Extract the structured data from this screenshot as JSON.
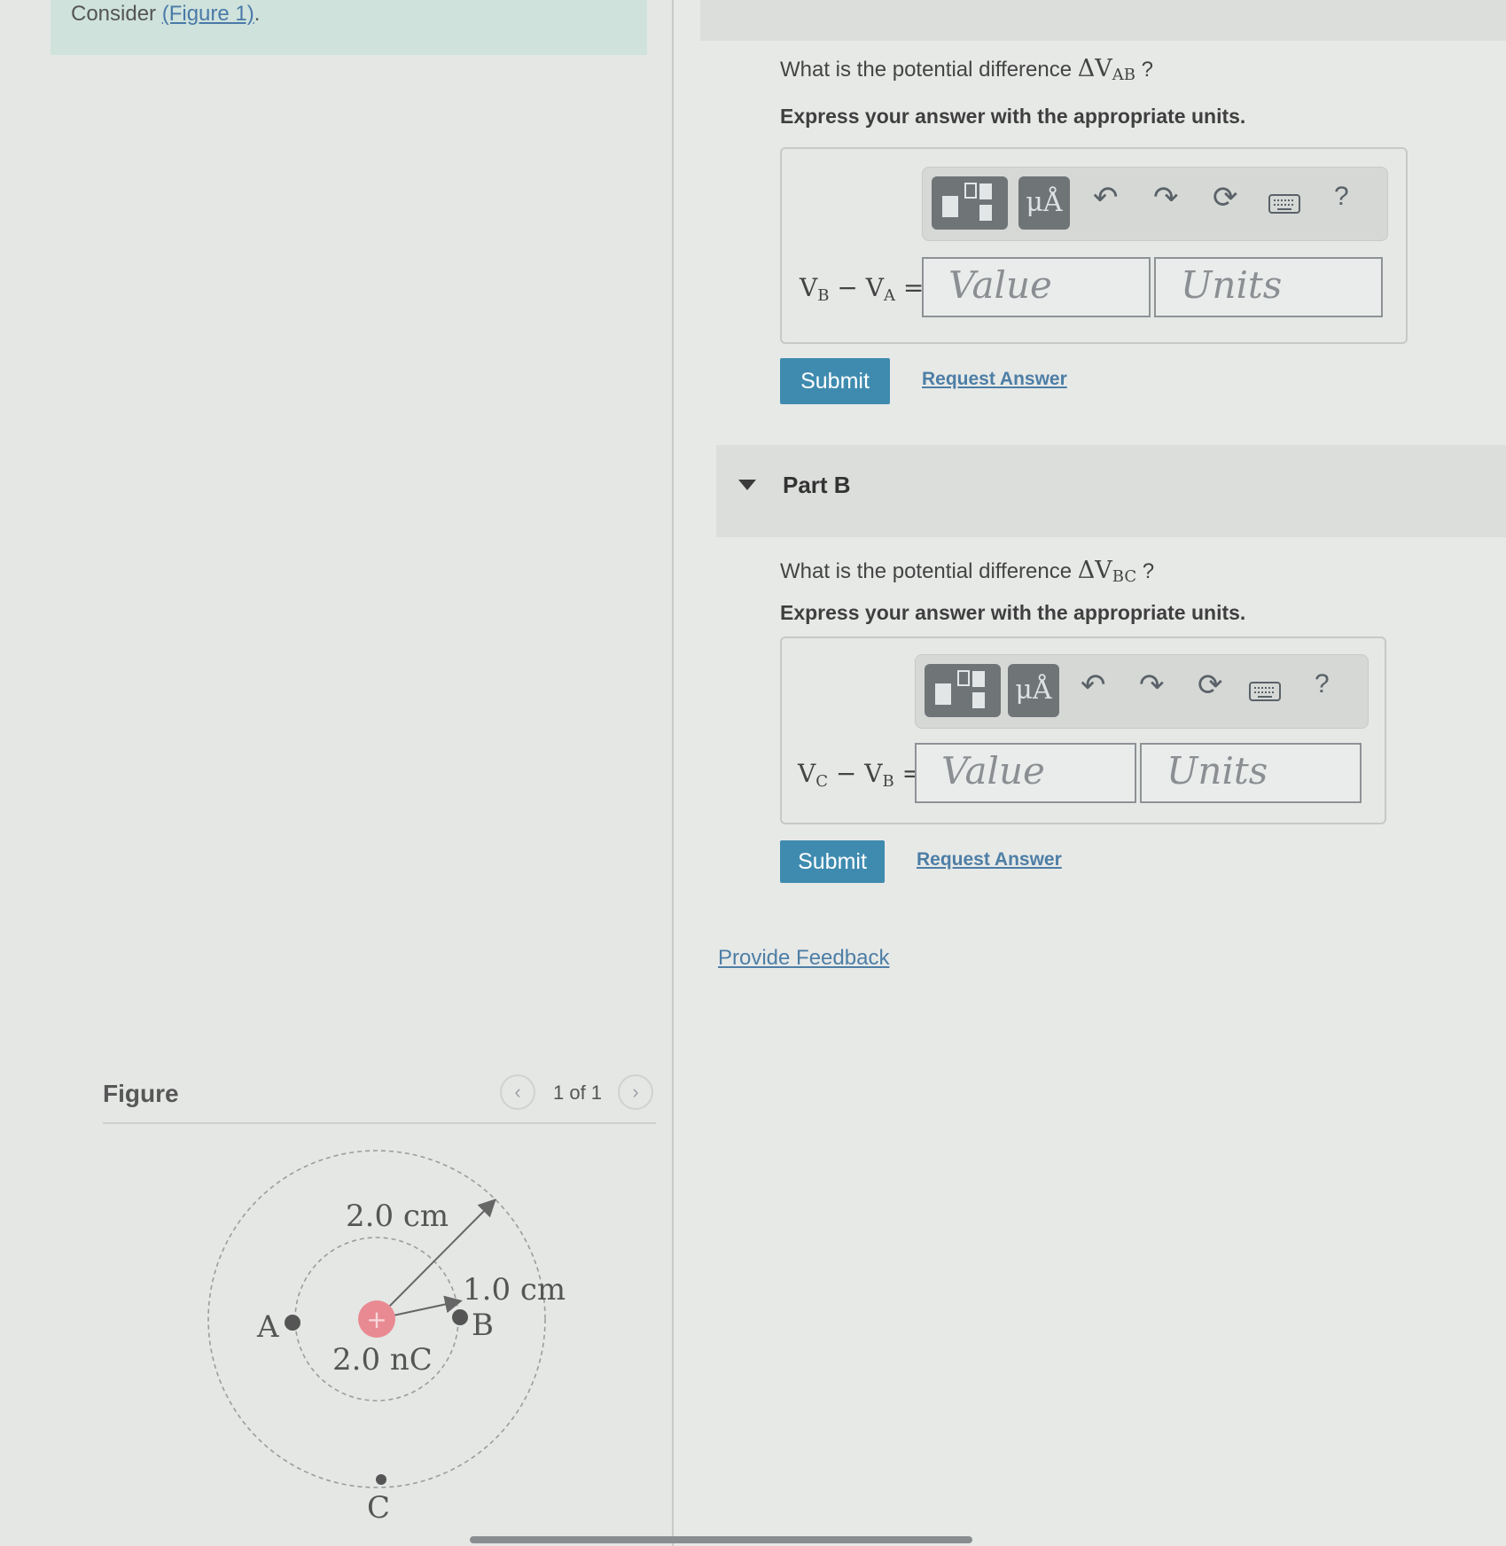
{
  "header": {
    "consider_text": "Consider ",
    "figure_link": "(Figure 1)",
    "consider_end": "."
  },
  "part_a": {
    "question_prefix": "What is the potential difference ",
    "question_symbol": "ΔV",
    "question_sub": "AB",
    "question_suffix": " ?",
    "instruction": "Express your answer with the appropriate units.",
    "equation": {
      "v1": "V",
      "s1": "B",
      "minus": " − V",
      "s2": "A",
      "eq": " ="
    },
    "value_placeholder": "Value",
    "units_placeholder": "Units",
    "submit_label": "Submit",
    "request_label": "Request Answer"
  },
  "part_b": {
    "header_label": "Part B",
    "question_prefix": "What is the potential difference ",
    "question_symbol": "ΔV",
    "question_sub": "BC",
    "question_suffix": " ?",
    "instruction": "Express your answer with the appropriate units.",
    "equation": {
      "v1": "V",
      "s1": "C",
      "minus": " − V",
      "s2": "B",
      "eq": " ="
    },
    "value_placeholder": "Value",
    "units_placeholder": "Units",
    "submit_label": "Submit",
    "request_label": "Request Answer"
  },
  "toolbar": {
    "units_icon_label": "μÅ",
    "undo_icon": "↶",
    "redo_icon": "↷",
    "reset_icon": "⟳",
    "help_label": "?"
  },
  "feedback_label": "Provide Feedback",
  "figure": {
    "title": "Figure",
    "prev": "‹",
    "next": "›",
    "pager": "1 of 1",
    "outer_radius_label": "2.0 cm",
    "inner_radius_label": "1.0 cm",
    "charge_label": "2.0 nC",
    "charge_sign": "+",
    "point_a": "A",
    "point_b": "B",
    "point_c": "C"
  },
  "colors": {
    "accent": "#3f8bb0",
    "link": "#4d7ea6",
    "charge": "#e98a92"
  }
}
